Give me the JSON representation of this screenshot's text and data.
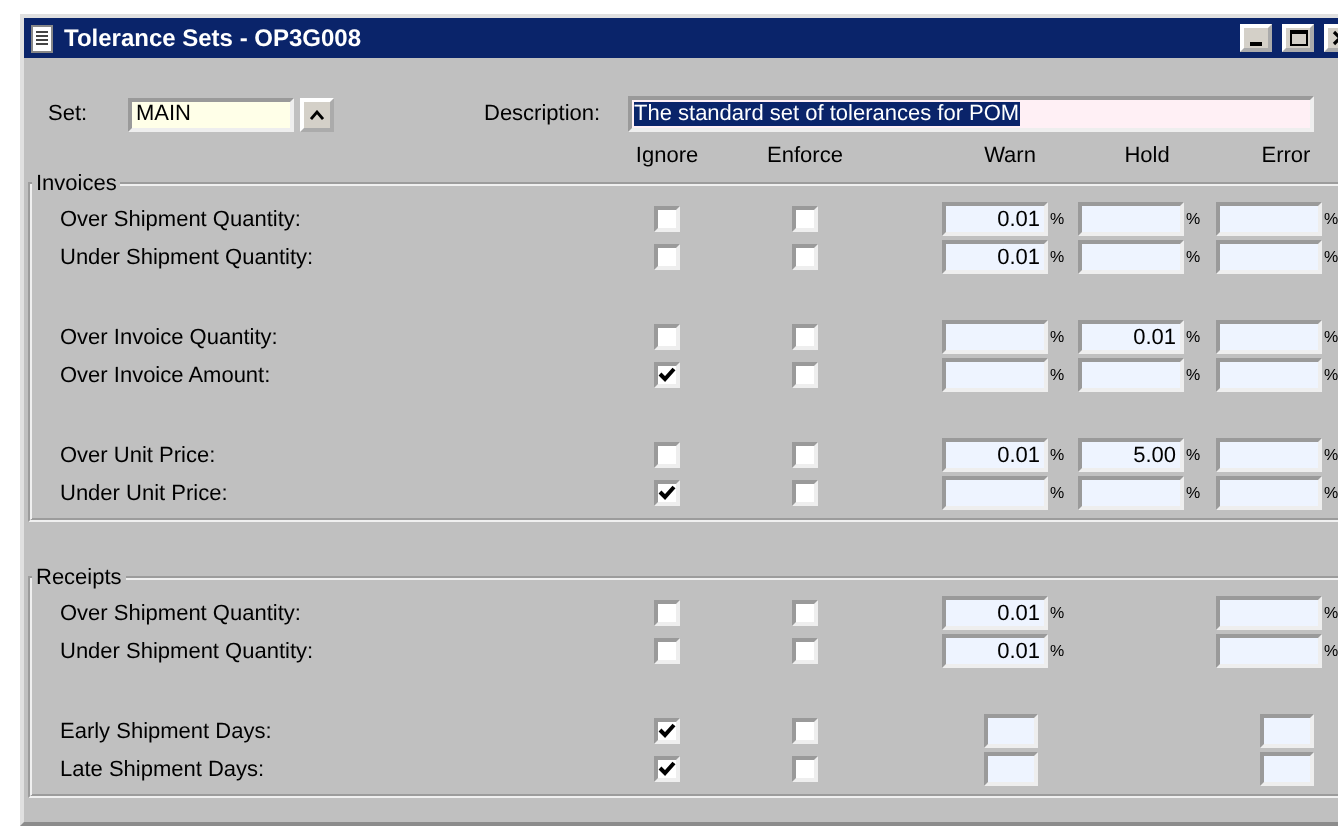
{
  "window": {
    "title": "Tolerance Sets - OP3G008"
  },
  "set": {
    "label": "Set:",
    "value": "MAIN"
  },
  "description": {
    "label": "Description:",
    "value": "The standard set of tolerances for POM",
    "selected": true
  },
  "columns": [
    "Ignore",
    "Enforce",
    "Warn",
    "Hold",
    "Error"
  ],
  "sections": [
    {
      "title": "Invoices",
      "groups": [
        [
          {
            "label": "Over Shipment Quantity:",
            "ignore": false,
            "enforce": false,
            "kind": "percent",
            "warn": {
              "value": "0.01",
              "suffix": "%"
            },
            "hold": {
              "suffix": "%"
            },
            "error": {
              "suffix": "%"
            }
          },
          {
            "label": "Under Shipment Quantity:",
            "ignore": false,
            "enforce": false,
            "kind": "percent",
            "warn": {
              "value": "0.01",
              "suffix": "%"
            },
            "hold": {
              "suffix": "%"
            },
            "error": {
              "suffix": "%"
            }
          }
        ],
        [
          {
            "label": "Over Invoice Quantity:",
            "ignore": false,
            "enforce": false,
            "kind": "percent",
            "warn": {
              "suffix": "%"
            },
            "hold": {
              "value": "0.01",
              "suffix": "%"
            },
            "error": {
              "suffix": "%"
            }
          },
          {
            "label": "Over Invoice Amount:",
            "ignore": true,
            "enforce": false,
            "kind": "percent",
            "warn": {
              "suffix": "%"
            },
            "hold": {
              "suffix": "%"
            },
            "error": {
              "suffix": "%"
            }
          }
        ],
        [
          {
            "label": "Over Unit Price:",
            "ignore": false,
            "enforce": false,
            "kind": "percent",
            "warn": {
              "value": "0.01",
              "suffix": "%"
            },
            "hold": {
              "value": "5.00",
              "suffix": "%"
            },
            "error": {
              "suffix": "%"
            }
          },
          {
            "label": "Under Unit Price:",
            "ignore": true,
            "enforce": false,
            "kind": "percent",
            "warn": {
              "suffix": "%"
            },
            "hold": {
              "suffix": "%"
            },
            "error": {
              "suffix": "%"
            }
          }
        ]
      ]
    },
    {
      "title": "Receipts",
      "groups": [
        [
          {
            "label": "Over Shipment Quantity:",
            "ignore": false,
            "enforce": false,
            "kind": "percent",
            "warn": {
              "value": "0.01",
              "suffix": "%"
            },
            "error": {
              "suffix": "%"
            }
          },
          {
            "label": "Under Shipment Quantity:",
            "ignore": false,
            "enforce": false,
            "kind": "percent",
            "warn": {
              "value": "0.01",
              "suffix": "%"
            },
            "error": {
              "suffix": "%"
            }
          }
        ],
        [
          {
            "label": "Early Shipment Days:",
            "ignore": true,
            "enforce": false,
            "kind": "days",
            "warn": true,
            "error": true
          },
          {
            "label": "Late Shipment Days:",
            "ignore": true,
            "enforce": false,
            "kind": "days",
            "warn": true,
            "error": true
          }
        ]
      ]
    }
  ]
}
